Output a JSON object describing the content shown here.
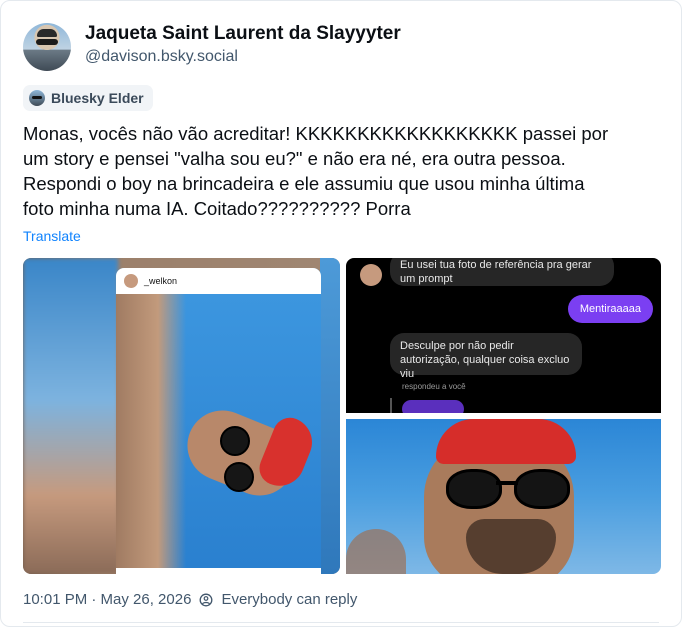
{
  "post": {
    "display_name": "Jaqueta Saint Laurent da Slayyyter",
    "handle": "@davison.bsky.social",
    "badge": "Bluesky Elder",
    "text": "Monas, vocês não vão acreditar! KKKKKKKKKKKKKKKKKK passei por\num story e pensei \"valha sou eu?\" e não era né, era outra pessoa.\nRespondi o boy na brincadeira e ele assumiu que usou minha última\nfoto minha numa IA. Coitado?????????? Porra",
    "translate_label": "Translate",
    "timestamp": "10:01 PM · May 26, 2026",
    "reply_setting": "Everybody can reply"
  },
  "media": {
    "story_username": "_welkon",
    "chat": {
      "msg_top": "Eu usei tua foto de referência pra gerar um prompt",
      "msg_sent": "Mentiraaaaa",
      "msg_reply": "Desculpe por não pedir autorização, qualquer coisa excluo viu",
      "replied_label": "respondeu a você"
    }
  },
  "colors": {
    "accent_link": "#1083fe",
    "chat_purple": "#7b3ff2",
    "muted_text": "#42576c"
  }
}
